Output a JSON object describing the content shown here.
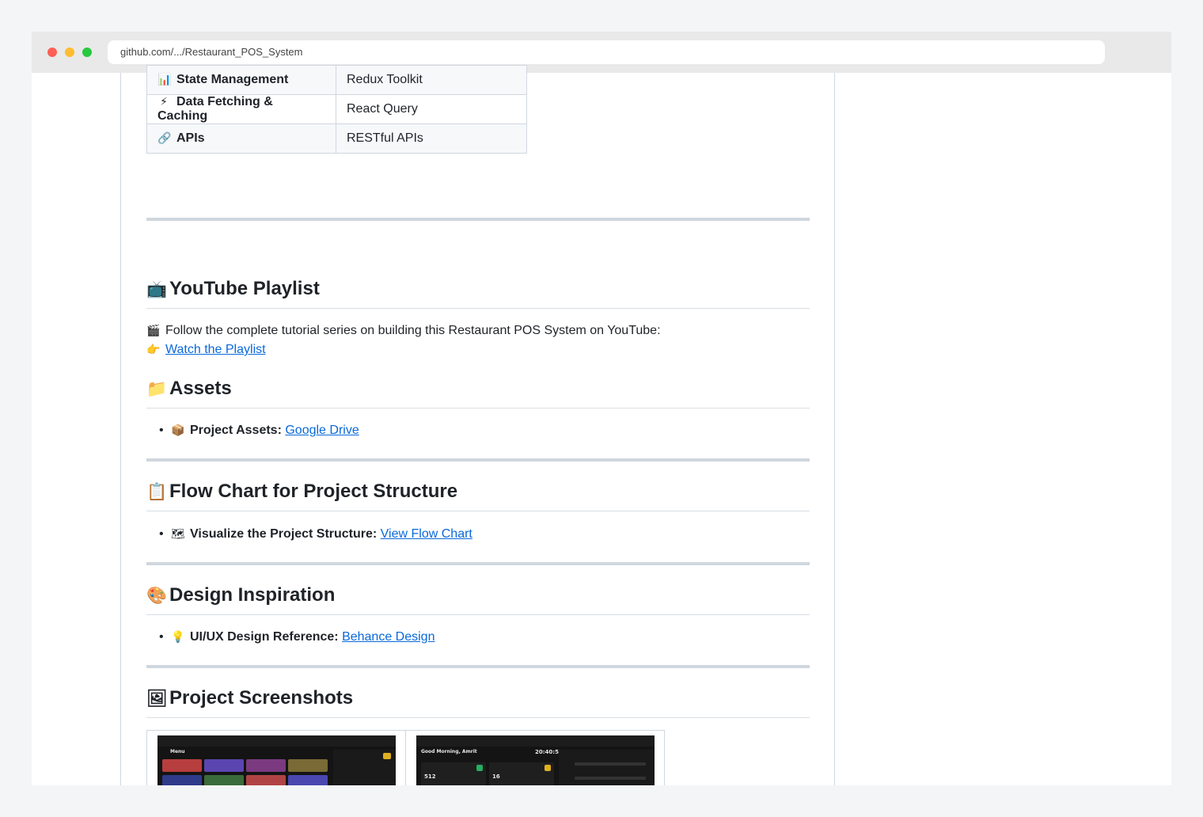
{
  "browser": {
    "url": "github.com/.../Restaurant_POS_System"
  },
  "tech_table": [
    {
      "icon": "📊",
      "label": "State Management",
      "value": "Redux Toolkit"
    },
    {
      "icon": "⚡",
      "label": "Data Fetching & Caching",
      "value": "React Query"
    },
    {
      "icon": "🔗",
      "label": "APIs",
      "value": "RESTful APIs"
    }
  ],
  "youtube": {
    "icon": "📺",
    "title": "YouTube Playlist",
    "intro_icon": "🎬",
    "intro": "Follow the complete tutorial series on building this Restaurant POS System on YouTube:",
    "link_icon": "👉",
    "link": "Watch the Playlist"
  },
  "assets": {
    "icon": "📁",
    "title": "Assets",
    "item_icon": "📦",
    "item_label": "Project Assets:",
    "item_link": "Google Drive"
  },
  "flow": {
    "icon": "📋",
    "title": "Flow Chart for Project Structure",
    "item_icon": "🗺",
    "item_label": "Visualize the Project Structure:",
    "item_link": "View Flow Chart"
  },
  "design": {
    "icon": "🎨",
    "title": "Design Inspiration",
    "item_icon": "💡",
    "item_label": "UI/UX Design Reference:",
    "item_link": "Behance Design"
  },
  "screenshots": {
    "icon": "🖼",
    "title": "Project Screenshots",
    "shot1_heading": "Menu",
    "shot2_heading": "Good Morning, Amrit",
    "shot2_time": "20:40:53",
    "shot2_stat1": "512",
    "shot2_stat2": "16"
  }
}
